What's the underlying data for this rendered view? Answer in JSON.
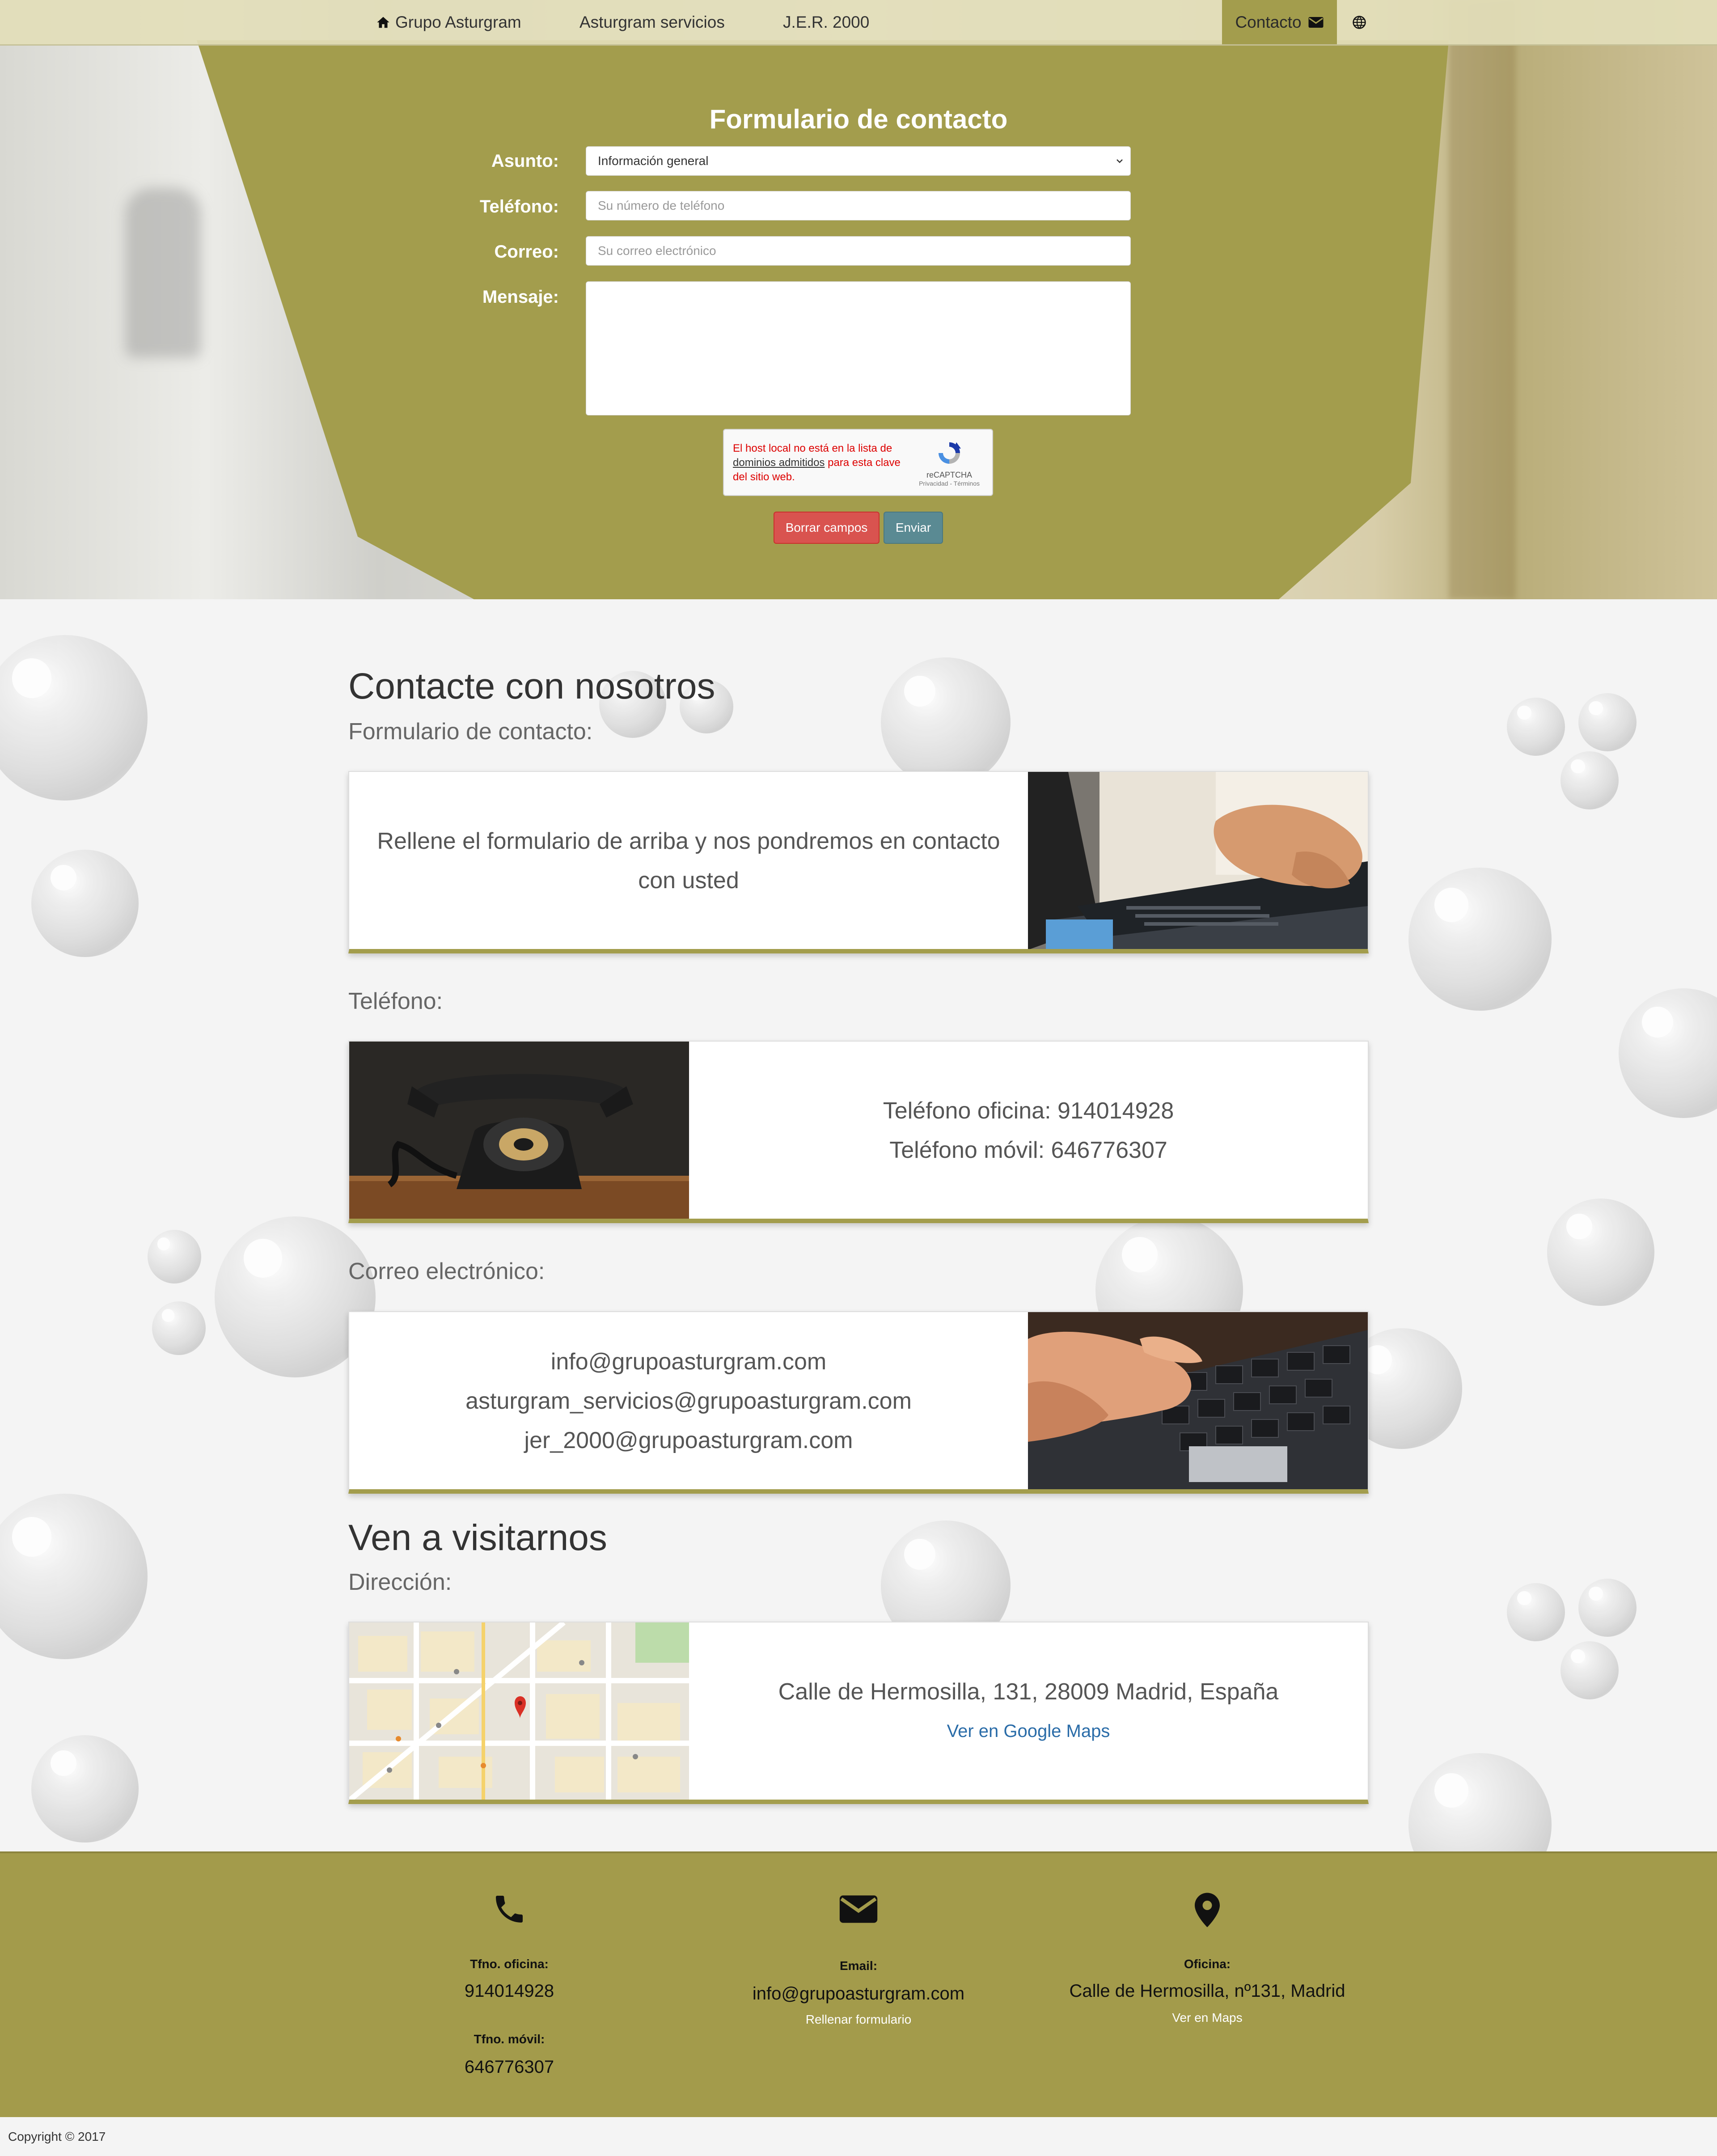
{
  "nav": {
    "items": [
      {
        "label": "Grupo Asturgram",
        "icon": "home-icon"
      },
      {
        "label": "Asturgram servicios"
      },
      {
        "label": "J.E.R. 2000"
      }
    ],
    "contact_label": "Contacto",
    "contact_icon": "mail-icon",
    "globe_icon": "globe-icon"
  },
  "form": {
    "title": "Formulario de contacto",
    "subject_label": "Asunto:",
    "subject_value": "Información general",
    "phone_label": "Teléfono:",
    "phone_placeholder": "Su número de teléfono",
    "email_label": "Correo:",
    "email_placeholder": "Su correo electrónico",
    "message_label": "Mensaje:",
    "message_value": "",
    "recaptcha": {
      "msg_1": "El host local no está en la lista de ",
      "msg_link": "dominios admitidos",
      "msg_2": " para esta clave del sitio web.",
      "brand": "reCAPTCHA",
      "links": "Privacidad - Términos"
    },
    "clear_label": "Borrar campos",
    "send_label": "Enviar"
  },
  "main": {
    "contact_heading": "Contacte con nosotros",
    "form_subheading": "Formulario de contacto:",
    "form_card_text_1": "Rellene el formulario de arriba y nos pondremos en contacto",
    "form_card_text_2": "con usted",
    "phone_subheading": "Teléfono:",
    "phone_office": "Teléfono oficina: 914014928",
    "phone_mobile": "Teléfono móvil: 646776307",
    "email_subheading": "Correo electrónico:",
    "emails": [
      "info@grupoasturgram.com",
      "asturgram_servicios@grupoasturgram.com",
      "jer_2000@grupoasturgram.com"
    ],
    "visit_heading": "Ven a visitarnos",
    "address_subheading": "Dirección:",
    "address": "Calle de Hermosilla, 131, 28009 Madrid, España",
    "maps_link": "Ver en Google Maps"
  },
  "footer": {
    "phone": {
      "icon": "phone-icon",
      "office_label": "Tfno. oficina:",
      "office_value": "914014928",
      "mobile_label": "Tfno. móvil:",
      "mobile_value": "646776307"
    },
    "email": {
      "icon": "mail-icon",
      "label": "Email:",
      "value": "info@grupoasturgram.com",
      "link": "Rellenar formulario"
    },
    "office": {
      "icon": "location-pin-icon",
      "label": "Oficina:",
      "value": "Calle de Hermosilla, nº131, Madrid",
      "link": "Ver en Maps"
    }
  },
  "copyright": "Copyright © 2017",
  "colors": {
    "accent": "#a39d4d",
    "danger": "#d9534f",
    "send": "#5a8a93",
    "link": "#2a6ca8"
  }
}
